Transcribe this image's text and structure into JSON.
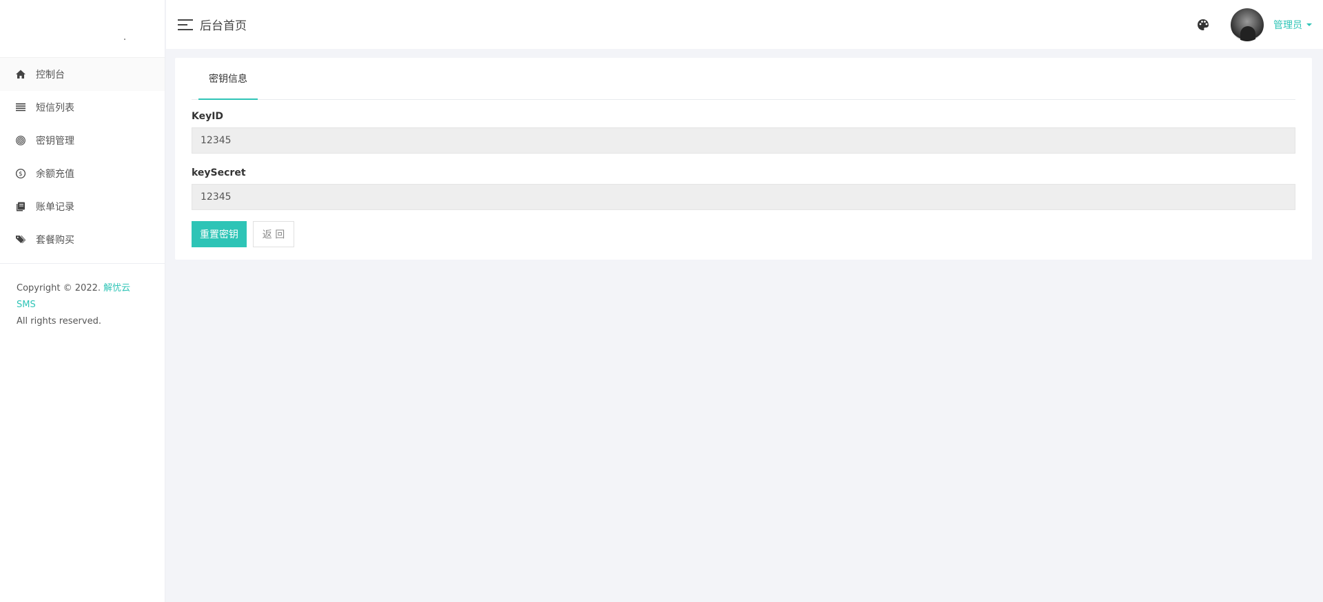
{
  "sidebar": {
    "items": [
      {
        "label": "控制台",
        "icon": "home-icon"
      },
      {
        "label": "短信列表",
        "icon": "list-icon"
      },
      {
        "label": "密钥管理",
        "icon": "fingerprint-icon"
      },
      {
        "label": "余额充值",
        "icon": "dollar-circle-icon"
      },
      {
        "label": "账单记录",
        "icon": "book-icon"
      },
      {
        "label": "套餐购买",
        "icon": "tags-icon"
      }
    ],
    "copyright_prefix": "Copyright © 2022.",
    "brand": "解忧云SMS",
    "rights": "All rights reserved."
  },
  "header": {
    "title": "后台首页",
    "user_name": "管理员"
  },
  "main": {
    "tab": "密钥信息",
    "key_id_label": "KeyID",
    "key_id_value": "12345",
    "key_secret_label": "keySecret",
    "key_secret_value": "12345",
    "reset_button": "重置密钥",
    "back_button": "返 回"
  },
  "colors": {
    "accent": "#2ec4b6",
    "page_bg": "#f3f4f8",
    "input_bg": "#eeeeee"
  }
}
